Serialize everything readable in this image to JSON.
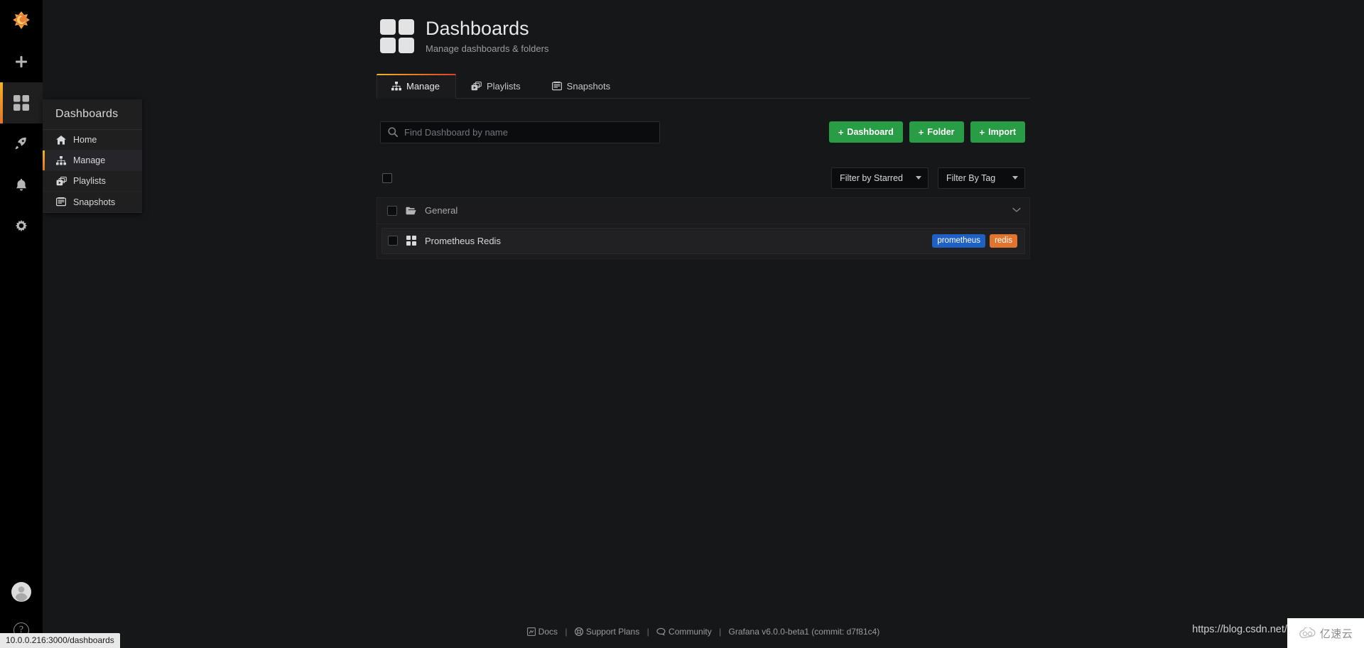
{
  "app": {
    "brand_icon": "grafana-logo-icon",
    "accent_orange": "#e0752d",
    "accent_yellow": "#f5b224",
    "green": "#299c46"
  },
  "sidemenu": {
    "items": [
      {
        "name": "create-add",
        "icon": "plus-icon",
        "label": "Create"
      },
      {
        "name": "dashboards",
        "icon": "dashboards-icon",
        "label": "Dashboards",
        "active": true
      },
      {
        "name": "explore",
        "icon": "rocket-icon",
        "label": "Explore"
      },
      {
        "name": "alerting",
        "icon": "bell-icon",
        "label": "Alerting"
      },
      {
        "name": "configuration",
        "icon": "gear-icon",
        "label": "Configuration"
      }
    ],
    "bottom": [
      {
        "name": "user-avatar",
        "icon": "avatar-icon",
        "label": "User"
      },
      {
        "name": "help",
        "icon": "question-icon",
        "label": "?"
      }
    ]
  },
  "menu_panel": {
    "header": "Dashboards",
    "items": [
      {
        "label": "Home",
        "icon": "home-icon",
        "active": false
      },
      {
        "label": "Manage",
        "icon": "sitemap-icon",
        "active": true
      },
      {
        "label": "Playlists",
        "icon": "playlist-icon",
        "active": false
      },
      {
        "label": "Snapshots",
        "icon": "camera-icon",
        "active": false
      }
    ]
  },
  "header": {
    "icon": "dashboards-grid-icon",
    "title": "Dashboards",
    "subtitle": "Manage dashboards & folders"
  },
  "tabs": [
    {
      "label": "Manage",
      "icon": "sitemap-icon",
      "active": true
    },
    {
      "label": "Playlists",
      "icon": "playlist-icon",
      "active": false
    },
    {
      "label": "Snapshots",
      "icon": "camera-icon",
      "active": false
    }
  ],
  "search": {
    "placeholder": "Find Dashboard by name",
    "value": "",
    "icon": "search-icon"
  },
  "actions": [
    {
      "label": "Dashboard",
      "icon": "plus-icon"
    },
    {
      "label": "Folder",
      "icon": "plus-icon"
    },
    {
      "label": "Import",
      "icon": "plus-icon"
    }
  ],
  "filters": [
    {
      "name": "filter-by-starred",
      "label": "Filter by Starred"
    },
    {
      "name": "filter-by-tag",
      "label": "Filter By Tag"
    }
  ],
  "list": {
    "select_all_checked": false,
    "folders": [
      {
        "name": "General",
        "icon": "folder-open-icon",
        "checked": false,
        "expanded": true,
        "chevron": "⌄",
        "dashboards": [
          {
            "title": "Prometheus Redis",
            "icon": "dashboard-grid-icon",
            "checked": false,
            "tags": [
              {
                "label": "prometheus",
                "color": "#1f60c4"
              },
              {
                "label": "redis",
                "color": "#e0752d"
              }
            ]
          }
        ]
      }
    ]
  },
  "footer": {
    "links": [
      {
        "label": "Docs",
        "icon": "doc-icon"
      },
      {
        "label": "Support Plans",
        "icon": "lifebuoy-icon"
      },
      {
        "label": "Community",
        "icon": "comment-icon"
      }
    ],
    "version": "Grafana v6.0.0-beta1 (commit: d7f81c4)",
    "separator": "|"
  },
  "statusbar": {
    "url": "10.0.0.216:3000/dashboards"
  },
  "overlay": {
    "url_hint": "https://blog.csdn.net/q",
    "watermark_text": "亿速云",
    "watermark_icon": "cloud-icon"
  }
}
